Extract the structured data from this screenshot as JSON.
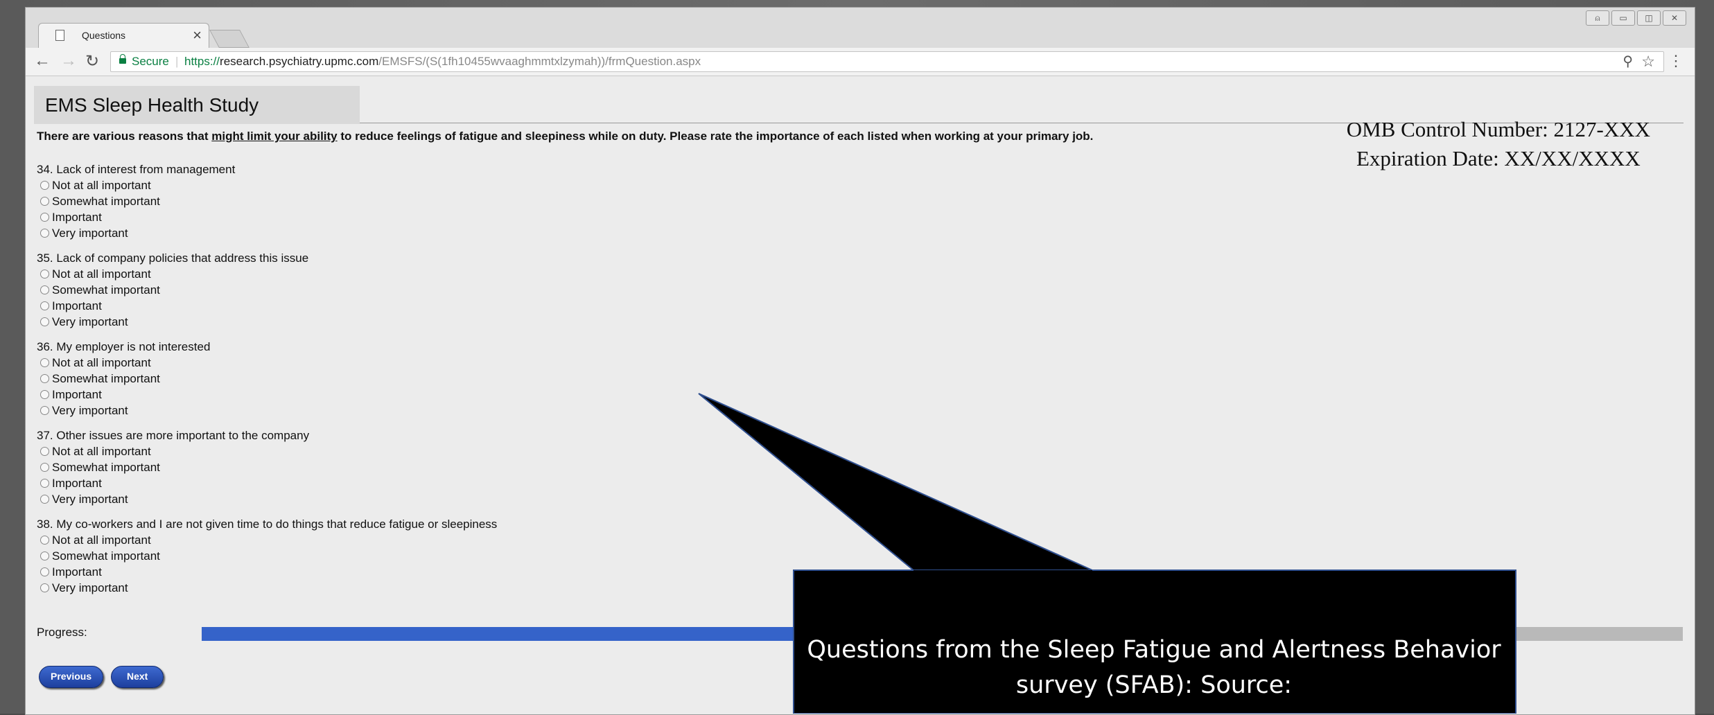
{
  "browser": {
    "tab_title": "Questions",
    "secure_label": "Secure",
    "url_scheme": "https://",
    "url_host": "research.psychiatry.upmc.com",
    "url_path": "/EMSFS/(S(1fh10455wvaaghmmtxlzymah))/frmQuestion.aspx"
  },
  "header": {
    "study_title": "EMS Sleep Health Study",
    "omb_control": "OMB Control Number: 2127-XXX",
    "expiration": "Expiration Date:  XX/XX/XXXX"
  },
  "instructions": {
    "pre": "There are various reasons that ",
    "underlined": "might limit your ability",
    "post": " to reduce feelings of fatigue and sleepiness while on duty. Please rate the importance of each listed when working at your primary job."
  },
  "questions": [
    {
      "text": "34. Lack of interest from management",
      "options": [
        "Not at all important",
        "Somewhat important",
        "Important",
        "Very important"
      ]
    },
    {
      "text": "35. Lack of company policies that address this issue",
      "options": [
        "Not at all important",
        "Somewhat important",
        "Important",
        "Very important"
      ]
    },
    {
      "text": "36. My employer is not interested",
      "options": [
        "Not at all important",
        "Somewhat important",
        "Important",
        "Very important"
      ]
    },
    {
      "text": "37. Other issues are more important to the company",
      "options": [
        "Not at all important",
        "Somewhat important",
        "Important",
        "Very important"
      ]
    },
    {
      "text": "38. My co-workers and I are not given time to do things that reduce fatigue or sleepiness",
      "options": [
        "Not at all important",
        "Somewhat important",
        "Important",
        "Very important"
      ]
    }
  ],
  "progress": {
    "label": "Progress:",
    "fraction": 0.85
  },
  "buttons": {
    "previous": "Previous",
    "next": "Next"
  },
  "callout": {
    "text": "Questions from the Sleep Fatigue and Alertness Behavior survey (SFAB): Source:"
  },
  "colors": {
    "progress_fill": "#3563c9",
    "secure_green": "#0b8043",
    "callout_bg": "#000000"
  }
}
